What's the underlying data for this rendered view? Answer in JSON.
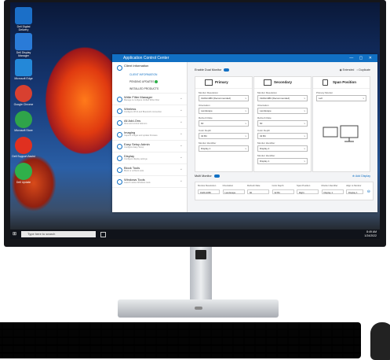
{
  "desktop": {
    "icons": [
      {
        "name": "dell-icon",
        "label": "Dell Digital Delivery",
        "color": "#1b6fc8"
      },
      {
        "name": "monitor-icon",
        "label": "Dell Display Manager",
        "color": "#2a7bd8"
      },
      {
        "name": "browser-icon",
        "label": "Microsoft Edge",
        "color": "#2488d8"
      },
      {
        "name": "chrome-icon",
        "label": "Google Chrome",
        "color": "#d84030"
      },
      {
        "name": "store-icon",
        "label": "Microsoft Store",
        "color": "#2fa44a"
      },
      {
        "name": "record-icon",
        "label": "Dell Support Assist",
        "color": "#e03020"
      },
      {
        "name": "green-icon",
        "label": "Dell Update",
        "color": "#2fb04a"
      }
    ]
  },
  "taskbar": {
    "search_placeholder": "Type here to search",
    "time": "8:49 AM",
    "date": "1/24/2022"
  },
  "app": {
    "title": "Application Control Center",
    "window_controls": "— ▢ ✕",
    "sidebar": {
      "client_info": "Client Information",
      "sub_items": [
        "CLIENT INFORMATION",
        "PENDING UPDATES",
        "INSTALLED PRODUCTS"
      ],
      "items": [
        {
          "title": "Write Filter Manager",
          "sub": "Manage & configure Unified Write Filter"
        },
        {
          "title": "Wireless",
          "sub": "Configure Wi-Fi and Bluetooth connection"
        },
        {
          "title": "All Add-Ons",
          "sub": "View and control Add-ons"
        },
        {
          "title": "Imaging",
          "sub": "Capture images and update firmware"
        },
        {
          "title": "Easy Setup Admin",
          "sub": "Configure Easy Setup"
        },
        {
          "title": "Display",
          "sub": "Configure display settings"
        },
        {
          "title": "Block Tools",
          "sub": "Block or unblock tools"
        },
        {
          "title": "Windows Tools",
          "sub": "Launch native Windows tools"
        }
      ]
    },
    "main": {
      "dual_monitor": "Enable Dual Monitor",
      "radio_extended": "Extended",
      "radio_duplicate": "Duplicate",
      "primary": {
        "title": "Primary",
        "fields": [
          {
            "label": "Monitor Resolution",
            "value": "1920x1080 (Recommended)"
          },
          {
            "label": "Orientation",
            "value": "Landscape"
          },
          {
            "label": "Refresh Rate",
            "value": "60"
          },
          {
            "label": "Color Depth",
            "value": "32 Bit"
          },
          {
            "label": "Monitor Identifier",
            "value": "Display 1"
          }
        ]
      },
      "secondary": {
        "title": "Secondary",
        "fields": [
          {
            "label": "Monitor Resolution",
            "value": "1920x1080 (Recommended)"
          },
          {
            "label": "Orientation",
            "value": "Landscape"
          },
          {
            "label": "Refresh Rate",
            "value": "60"
          },
          {
            "label": "Color Depth",
            "value": "32 Bit"
          },
          {
            "label": "Monitor Identifier",
            "value": "Display 2"
          },
          {
            "label": "Monitor Identifier",
            "value": "Display 1"
          }
        ]
      },
      "span": {
        "title": "Span Position",
        "field_label": "Primary Monitor",
        "field_value": "Left"
      },
      "multi_monitor": "Multi Monitor",
      "add_display": "Add Display",
      "table_headers": [
        "Monitor Resolution",
        "Orientation",
        "Refresh Rate",
        "Color Depth",
        "Span Position",
        "Monitor Identifier",
        "Align to Monitor"
      ],
      "table_row": [
        "1920x1080",
        "Landscape",
        "60",
        "32 Bit",
        "Right",
        "Display 1",
        "Display 1"
      ]
    }
  }
}
